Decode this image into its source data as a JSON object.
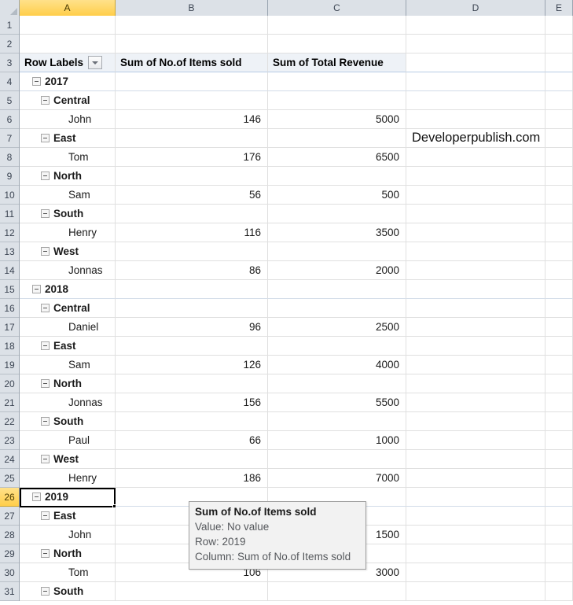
{
  "spreadsheet": {
    "column_headers": [
      "A",
      "B",
      "C",
      "D",
      "E"
    ],
    "active_column": "A",
    "active_row": "26",
    "row_numbers": [
      "1",
      "2",
      "3",
      "4",
      "5",
      "6",
      "7",
      "8",
      "9",
      "10",
      "11",
      "12",
      "13",
      "14",
      "15",
      "16",
      "17",
      "18",
      "19",
      "20",
      "21",
      "22",
      "23",
      "24",
      "25",
      "26",
      "27",
      "28",
      "29",
      "30",
      "31"
    ],
    "select_all_icon": "select-all-triangle"
  },
  "pivot_header": {
    "row_labels": "Row Labels",
    "filter_icon": "filter-dropdown-icon",
    "col_b": "Sum of No.of Items sold",
    "col_c": "Sum of Total Revenue"
  },
  "watermark": {
    "text": "Developerpublish.com",
    "cell": "D7"
  },
  "rows": [
    {
      "row": "1",
      "level": "",
      "label": "",
      "expander": false,
      "b": "",
      "c": "",
      "d": ""
    },
    {
      "row": "2",
      "level": "",
      "label": "",
      "expander": false,
      "b": "",
      "c": "",
      "d": ""
    },
    {
      "row": "4",
      "level": "year",
      "label": "2017",
      "expander": true,
      "b": "",
      "c": "",
      "d": ""
    },
    {
      "row": "5",
      "level": "region",
      "label": "Central",
      "expander": true,
      "b": "",
      "c": "",
      "d": ""
    },
    {
      "row": "6",
      "level": "name",
      "label": "John",
      "expander": false,
      "b": "146",
      "c": "5000",
      "d": ""
    },
    {
      "row": "7",
      "level": "region",
      "label": "East",
      "expander": true,
      "b": "",
      "c": "",
      "d": "Developerpublish.com"
    },
    {
      "row": "8",
      "level": "name",
      "label": "Tom",
      "expander": false,
      "b": "176",
      "c": "6500",
      "d": ""
    },
    {
      "row": "9",
      "level": "region",
      "label": "North",
      "expander": true,
      "b": "",
      "c": "",
      "d": ""
    },
    {
      "row": "10",
      "level": "name",
      "label": "Sam",
      "expander": false,
      "b": "56",
      "c": "500",
      "d": ""
    },
    {
      "row": "11",
      "level": "region",
      "label": "South",
      "expander": true,
      "b": "",
      "c": "",
      "d": ""
    },
    {
      "row": "12",
      "level": "name",
      "label": "Henry",
      "expander": false,
      "b": "116",
      "c": "3500",
      "d": ""
    },
    {
      "row": "13",
      "level": "region",
      "label": "West",
      "expander": true,
      "b": "",
      "c": "",
      "d": ""
    },
    {
      "row": "14",
      "level": "name",
      "label": "Jonnas",
      "expander": false,
      "b": "86",
      "c": "2000",
      "d": ""
    },
    {
      "row": "15",
      "level": "year",
      "label": "2018",
      "expander": true,
      "b": "",
      "c": "",
      "d": ""
    },
    {
      "row": "16",
      "level": "region",
      "label": "Central",
      "expander": true,
      "b": "",
      "c": "",
      "d": ""
    },
    {
      "row": "17",
      "level": "name",
      "label": "Daniel",
      "expander": false,
      "b": "96",
      "c": "2500",
      "d": ""
    },
    {
      "row": "18",
      "level": "region",
      "label": "East",
      "expander": true,
      "b": "",
      "c": "",
      "d": ""
    },
    {
      "row": "19",
      "level": "name",
      "label": "Sam",
      "expander": false,
      "b": "126",
      "c": "4000",
      "d": ""
    },
    {
      "row": "20",
      "level": "region",
      "label": "North",
      "expander": true,
      "b": "",
      "c": "",
      "d": ""
    },
    {
      "row": "21",
      "level": "name",
      "label": "Jonnas",
      "expander": false,
      "b": "156",
      "c": "5500",
      "d": ""
    },
    {
      "row": "22",
      "level": "region",
      "label": "South",
      "expander": true,
      "b": "",
      "c": "",
      "d": ""
    },
    {
      "row": "23",
      "level": "name",
      "label": "Paul",
      "expander": false,
      "b": "66",
      "c": "1000",
      "d": ""
    },
    {
      "row": "24",
      "level": "region",
      "label": "West",
      "expander": true,
      "b": "",
      "c": "",
      "d": ""
    },
    {
      "row": "25",
      "level": "name",
      "label": "Henry",
      "expander": false,
      "b": "186",
      "c": "7000",
      "d": ""
    },
    {
      "row": "26",
      "level": "year",
      "label": "2019",
      "expander": true,
      "b": "",
      "c": "",
      "d": ""
    },
    {
      "row": "27",
      "level": "region",
      "label": "East",
      "expander": true,
      "b": "",
      "c": "",
      "d": ""
    },
    {
      "row": "28",
      "level": "name",
      "label": "John",
      "expander": false,
      "b": "",
      "c": "1500",
      "d": ""
    },
    {
      "row": "29",
      "level": "region",
      "label": "North",
      "expander": true,
      "b": "",
      "c": "",
      "d": ""
    },
    {
      "row": "30",
      "level": "name",
      "label": "Tom",
      "expander": false,
      "b": "106",
      "c": "3000",
      "d": ""
    },
    {
      "row": "31",
      "level": "region",
      "label": "South",
      "expander": true,
      "b": "",
      "c": "",
      "d": ""
    }
  ],
  "tooltip": {
    "title": "Sum of No.of Items sold",
    "value_line": "Value: No value",
    "row_line": "Row: 2019",
    "column_line": "Column: Sum of No.of Items sold"
  },
  "colors": {
    "header_fill": "#dce1e7",
    "active_header_fill": "#ffd866",
    "pivot_header_fill": "#eef2f7",
    "gridline": "#e0e0e0",
    "tooltip_fill": "#f2f2f2",
    "tooltip_border": "#9f9f9f"
  }
}
